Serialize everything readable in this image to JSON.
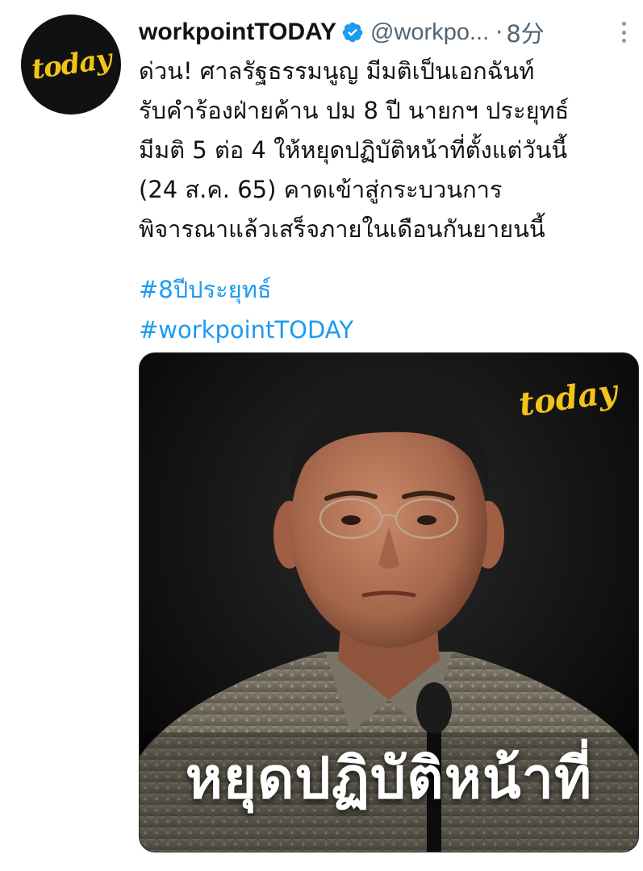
{
  "tweet": {
    "avatar": {
      "logo_text": "today",
      "logo_color": "#F2C418"
    },
    "author": {
      "display_name": "workpointTODAY",
      "verified": true,
      "handle": "@workpo...",
      "separator": "·",
      "time": "8分"
    },
    "more_icon": "more-vertical-icon",
    "body_lines": [
      "ด่วน! ศาลรัฐธรรมนูญ มีมติเป็นเอกฉันท์",
      "รับคำร้องฝ่ายค้าน ปม 8 ปี นายกฯ ประยุทธ์",
      "มีมติ 5 ต่อ 4 ให้หยุดปฏิบัติหน้าที่ตั้งแต่วันนี้",
      "(24 ส.ค. 65) คาดเข้าสู่กระบวนการ",
      "พิจารณาแล้วเสร็จภายในเดือนกันยายนนี้"
    ],
    "hashtags": [
      "#8ปีประยุทธ์",
      "#workpointTODAY"
    ],
    "media": {
      "logo_text": "today",
      "caption": "หยุดปฏิบัติหน้าที่"
    }
  },
  "colors": {
    "text": "#0f1419",
    "secondary": "#536471",
    "link": "#1d9bf0",
    "verified": "#1d9bf0",
    "brand_yellow": "#F2C418"
  }
}
